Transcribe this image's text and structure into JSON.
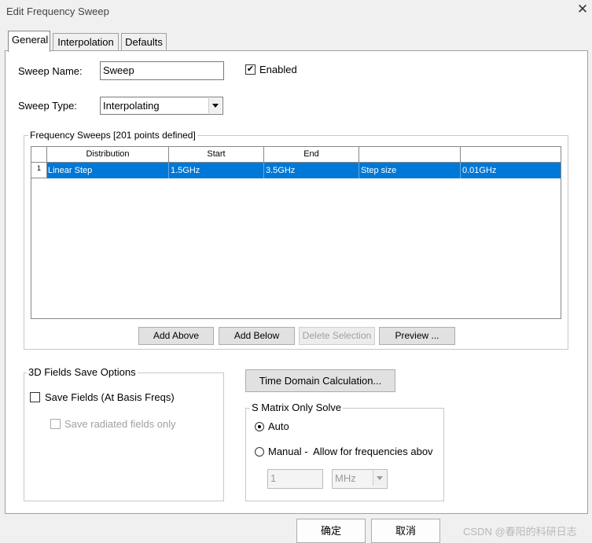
{
  "window": {
    "title": "Edit Frequency Sweep"
  },
  "tabs": [
    "General",
    "Interpolation",
    "Defaults"
  ],
  "general": {
    "sweep_name_label": "Sweep Name:",
    "sweep_name_value": "Sweep",
    "enabled_label": "Enabled",
    "enabled_checked": true,
    "sweep_type_label": "Sweep Type:",
    "sweep_type_value": "Interpolating"
  },
  "freq_sweeps": {
    "group_label": "Frequency Sweeps [201 points defined]",
    "columns": [
      "Distribution",
      "Start",
      "End",
      "",
      ""
    ],
    "rows": [
      {
        "num": "1",
        "cells": [
          "Linear Step",
          "1.5GHz",
          "3.5GHz",
          "Step size",
          "0.01GHz"
        ],
        "selected": true
      }
    ],
    "buttons": {
      "add_above": "Add Above",
      "add_below": "Add Below",
      "delete_selection": "Delete Selection",
      "preview": "Preview ..."
    }
  },
  "fields_save": {
    "group_label": "3D Fields Save Options",
    "save_fields_label": "Save Fields (At Basis Freqs)",
    "save_radiated_label": "Save radiated fields only"
  },
  "time_domain_button": "Time Domain Calculation...",
  "s_matrix": {
    "group_label": "S Matrix Only Solve",
    "auto_label": "Auto",
    "manual_label": "Manual -  Allow for frequencies abov",
    "selected": "auto",
    "freq_value": "1",
    "unit_value": "MHz"
  },
  "footer": {
    "ok": "确定",
    "cancel": "取消"
  },
  "watermark": "CSDN @春阳的科研日志"
}
